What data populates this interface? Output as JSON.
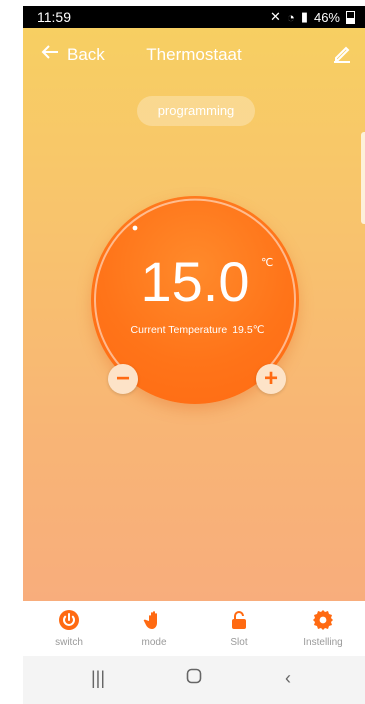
{
  "statusbar": {
    "time": "11:59",
    "battery_percent": "46%"
  },
  "header": {
    "back_label": "Back",
    "title": "Thermostaat",
    "edit_icon": "pencil-icon"
  },
  "mode_pill": "programming",
  "dial": {
    "set_temperature": "15.0",
    "unit": "℃",
    "current_label": "Current Temperature",
    "current_value": "19.5℃"
  },
  "buttons": {
    "decrease_icon": "minus-icon",
    "increase_icon": "plus-icon"
  },
  "tabs": [
    {
      "label": "switch",
      "icon": "power-icon",
      "color": "#ff6a12"
    },
    {
      "label": "mode",
      "icon": "hand-icon",
      "color": "#ff6a12"
    },
    {
      "label": "Slot",
      "icon": "unlock-icon",
      "color": "#ff6a12"
    },
    {
      "label": "Instelling",
      "icon": "gear-icon",
      "color": "#ff6a12"
    }
  ],
  "system_nav": {
    "recent_icon": "recent-apps-icon",
    "home_icon": "home-icon",
    "back_icon": "back-chevron-icon"
  }
}
